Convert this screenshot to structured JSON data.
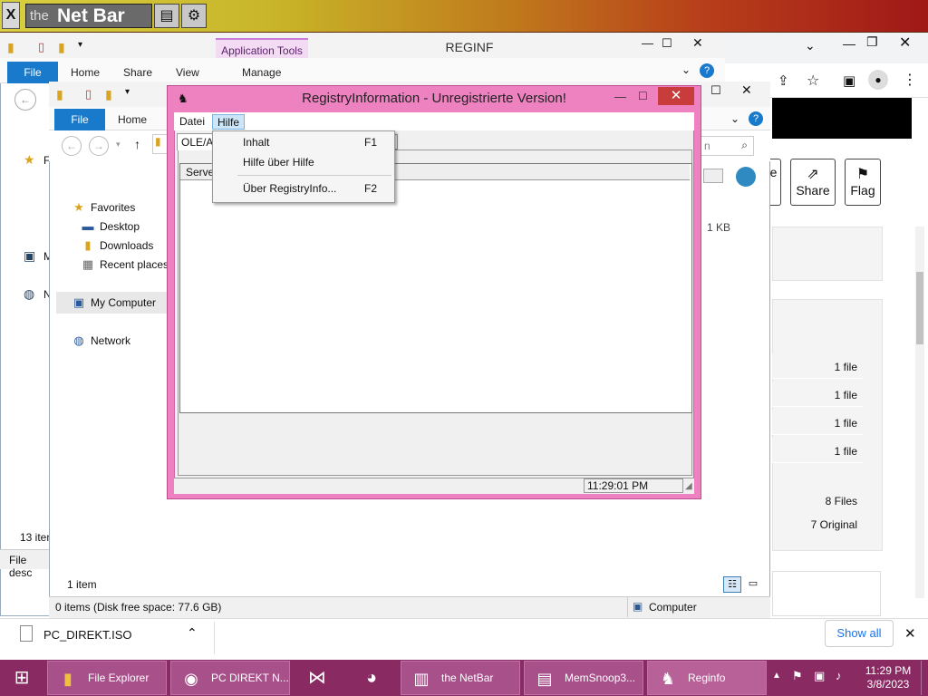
{
  "netbar": {
    "logo_small": "the",
    "logo_big": "Net Bar",
    "close": "X"
  },
  "explorer_back": {
    "title": "REGINF",
    "app_tools": "Application Tools",
    "tabs": [
      "File",
      "Home",
      "Share",
      "View",
      "Manage"
    ],
    "side_items": [
      "F",
      "M",
      "N"
    ],
    "count": "13 item",
    "desc": "File desc"
  },
  "explorer_front": {
    "tabs": [
      "File",
      "Home"
    ],
    "nav": {
      "favorites": "Favorites",
      "desktop": "Desktop",
      "downloads": "Downloads",
      "recent": "Recent places",
      "computer": "My Computer",
      "network": "Network"
    },
    "search_placeholder": "n",
    "size": "1 KB",
    "item_count": "1 item",
    "status_left": "0 items (Disk free space: 77.6 GB)",
    "status_right": "Computer"
  },
  "registry": {
    "title": "RegistryInformation - Unregistrierte Version!",
    "menu": [
      "Datei",
      "Hilfe"
    ],
    "tab_label": "OLE/A",
    "column_header": "Serve",
    "clock": "11:29:01 PM",
    "dropdown": [
      {
        "label": "Inhalt",
        "key": "F1"
      },
      {
        "label": "Hilfe über Hilfe",
        "key": ""
      },
      {
        "label": "Über RegistryInfo...",
        "key": "F2"
      }
    ]
  },
  "chrome_side": {
    "buttons": [
      "e",
      "Share",
      "Flag"
    ],
    "rows": [
      "1 file",
      "1 file",
      "1 file",
      "1 file"
    ],
    "files": "8 Files",
    "original": "7 Original"
  },
  "download_bar": {
    "file": "PC_DIREKT.ISO",
    "show_all": "Show all"
  },
  "taskbar": {
    "items": [
      "File Explorer",
      "PC DIREKT N...",
      "the NetBar",
      "MemSnoop3...",
      "Reginfo"
    ],
    "time": "11:29 PM",
    "date": "3/8/2023"
  }
}
